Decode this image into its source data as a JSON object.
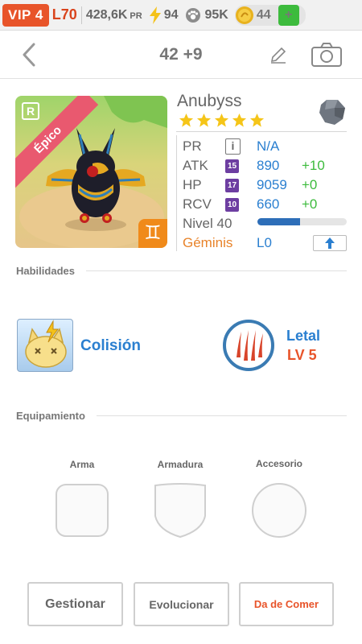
{
  "status": {
    "vip": "VIP 4",
    "level": "L70",
    "pr": "428,6K",
    "pr_unit": "PR",
    "energy": "94",
    "paws": "95K",
    "coins": "44",
    "add_label": "+"
  },
  "nav": {
    "title": "42 +9"
  },
  "monster": {
    "name": "Anubyss",
    "rarity": "Épico",
    "rank_badge": "R",
    "sign_symbol": "♊",
    "stars": 5,
    "stats": {
      "pr_label": "PR",
      "pr_info": "i",
      "pr_value": "N/A",
      "atk_label": "ATK",
      "atk_level": "15",
      "atk_value": "890",
      "atk_bonus": "+10",
      "hp_label": "HP",
      "hp_level": "17",
      "hp_value": "9059",
      "hp_bonus": "+0",
      "rcv_label": "RCV",
      "rcv_level": "10",
      "rcv_value": "660",
      "rcv_bonus": "+0",
      "level_label": "Nivel 40",
      "level_progress": 0.48,
      "sign_label": "Géminis",
      "sign_value": "L0"
    }
  },
  "skills": {
    "header": "Habilidades",
    "skill_name": "Colisión",
    "leader_name": "Letal",
    "leader_level": "LV 5"
  },
  "equipment": {
    "header": "Equipamiento",
    "weapon": "Arma",
    "armor": "Armadura",
    "accessory": "Accesorio"
  },
  "actions": {
    "manage": "Gestionar",
    "evolve": "Evolucionar",
    "feed": "Da de Comer"
  },
  "colors": {
    "vip": "#e8542a",
    "accent_blue": "#2a7fd0",
    "bonus_green": "#3dbb3d",
    "feed_red": "#e8542a",
    "gemini_orange": "#e8832a"
  }
}
